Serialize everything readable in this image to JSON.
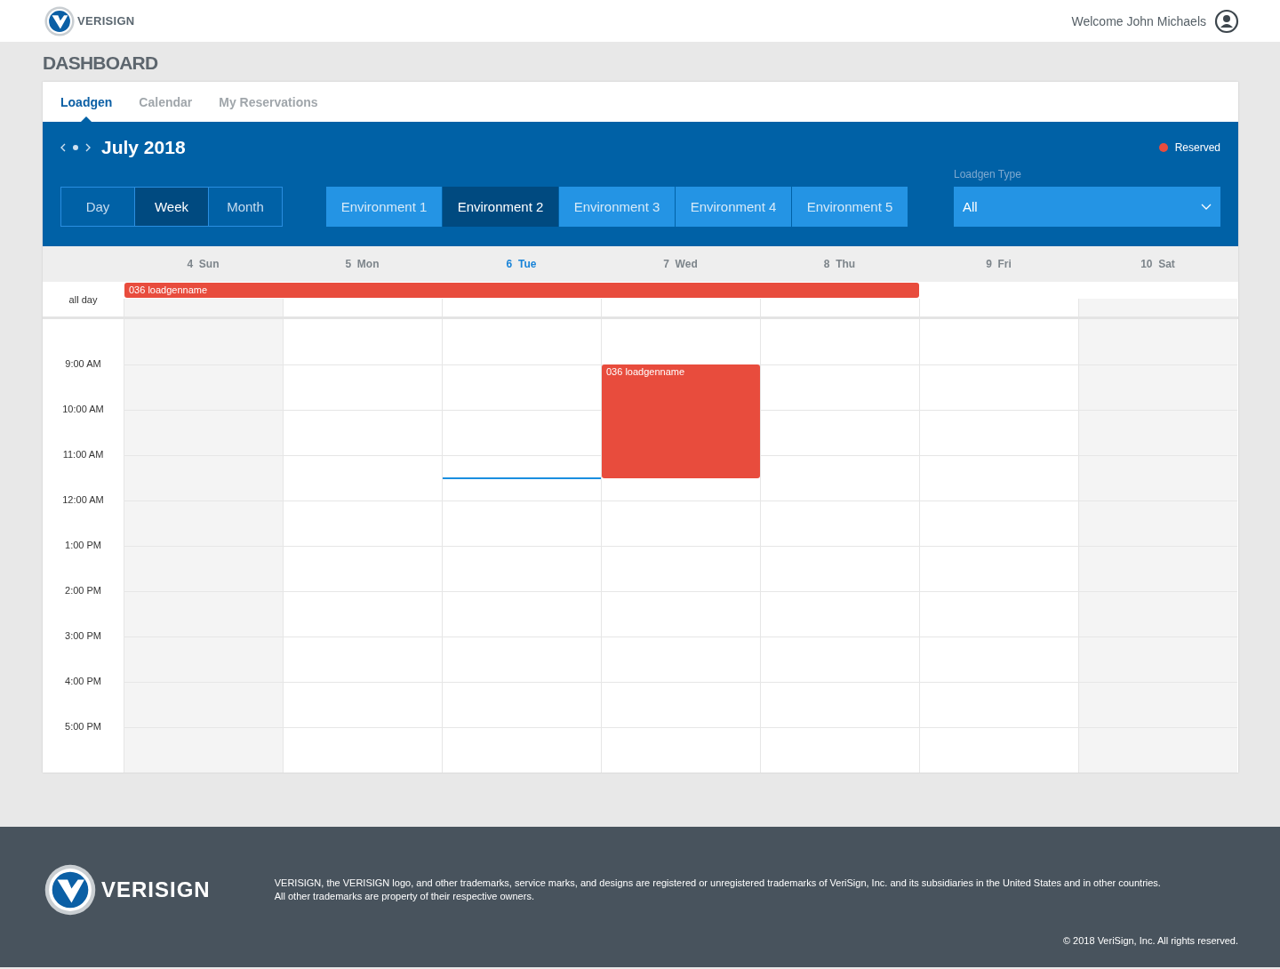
{
  "header": {
    "brand": "VERISIGN",
    "welcome": "Welcome John Michaels"
  },
  "page_title": "DASHBOARD",
  "tabs": [
    {
      "label": "Loadgen",
      "selected": true
    },
    {
      "label": "Calendar",
      "selected": false
    },
    {
      "label": "My Reservations",
      "selected": false
    }
  ],
  "calendar": {
    "title": "July 2018",
    "legend": {
      "label": "Reserved",
      "color": "#e84c3d"
    },
    "views": [
      {
        "label": "Day",
        "selected": false
      },
      {
        "label": "Week",
        "selected": true
      },
      {
        "label": "Month",
        "selected": false
      }
    ],
    "environments": [
      {
        "label": "Environment 1",
        "selected": false
      },
      {
        "label": "Environment 2",
        "selected": true
      },
      {
        "label": "Environment 3",
        "selected": false
      },
      {
        "label": "Environment 4",
        "selected": false
      },
      {
        "label": "Environment 5",
        "selected": false
      }
    ],
    "loadgen_type": {
      "label": "Loadgen Type",
      "value": "All"
    },
    "days": [
      {
        "number": "4",
        "name": "Sun",
        "today": false,
        "in_all_day_event": true
      },
      {
        "number": "5",
        "name": "Mon",
        "today": false,
        "in_all_day_event": true
      },
      {
        "number": "6",
        "name": "Tue",
        "today": true,
        "in_all_day_event": true
      },
      {
        "number": "7",
        "name": "Wed",
        "today": false,
        "in_all_day_event": true,
        "events": [
          {
            "title": "036 loadgenname"
          }
        ]
      },
      {
        "number": "8",
        "name": "Thu",
        "today": false,
        "in_all_day_event": true
      },
      {
        "number": "9",
        "name": "Fri",
        "today": false,
        "in_all_day_event": false
      },
      {
        "number": "10",
        "name": "Sat",
        "today": false,
        "in_all_day_event": false
      }
    ],
    "all_day_label": "all day",
    "all_day_event": {
      "title": "036 loadgenname"
    },
    "times": [
      "9:00 AM",
      "10:00 AM",
      "11:00 AM",
      "12:00 AM",
      "1:00 PM",
      "2:00 PM",
      "3:00 PM",
      "4:00 PM",
      "5:00 PM"
    ]
  },
  "footer": {
    "brand": "VERISIGN",
    "legal_lines": [
      "VERISIGN, the VERISIGN logo, and other trademarks, service marks, and designs are registered or unregistered trademarks of VeriSign, Inc. and its subsidiaries in the United States and in other countries.",
      "All other trademarks are property of their respective owners."
    ],
    "copyright": "© 2018 VeriSign, Inc. All rights reserved."
  }
}
